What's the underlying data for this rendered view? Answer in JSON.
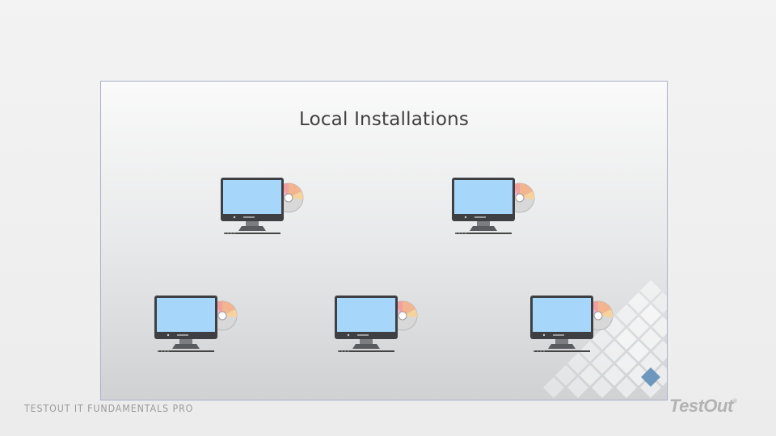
{
  "slide": {
    "title": "Local Installations",
    "icons": [
      "computer-with-install-disc-icon",
      "computer-with-install-disc-icon",
      "computer-with-install-disc-icon",
      "computer-with-install-disc-icon",
      "computer-with-install-disc-icon"
    ]
  },
  "footer": {
    "course": "TESTOUT IT FUNDAMENTALS PRO",
    "brand": "TestOut",
    "trademark": "®"
  },
  "colors": {
    "screen": "#a7d6fb",
    "monitor_frame": "#3e3f42",
    "accent_diamond": "#6d97bd",
    "title_text": "#3f3f3f",
    "footer_text": "#9a9a9a"
  }
}
